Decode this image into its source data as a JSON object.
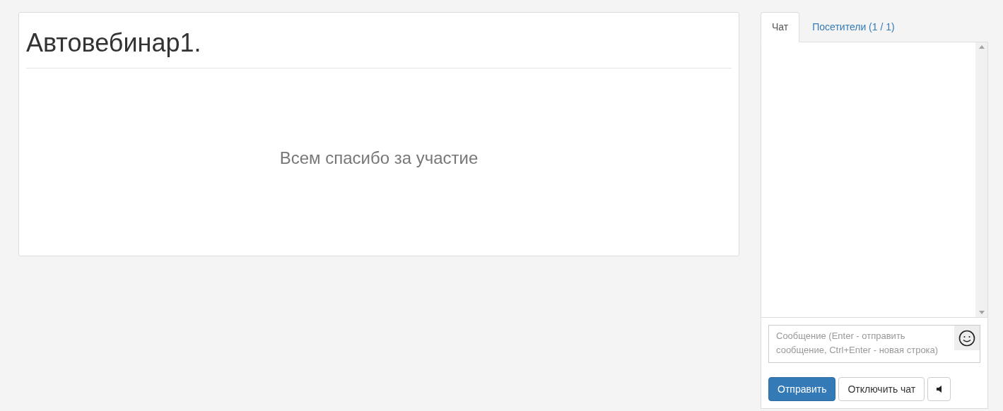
{
  "webinar": {
    "title": "Автовебинар1.",
    "message": "Всем спасибо за участие"
  },
  "chat": {
    "tabs": [
      {
        "label": "Чат",
        "selected": true
      },
      {
        "label": "Посетители (1 / 1)",
        "selected": false
      }
    ],
    "input": {
      "placeholder": "Сообщение (Enter - отправить сообщение, Ctrl+Enter - новая строка)"
    },
    "buttons": [
      {
        "label": "Отправить",
        "kind": "primary"
      },
      {
        "label": "Отключить чат",
        "kind": "default"
      }
    ]
  }
}
